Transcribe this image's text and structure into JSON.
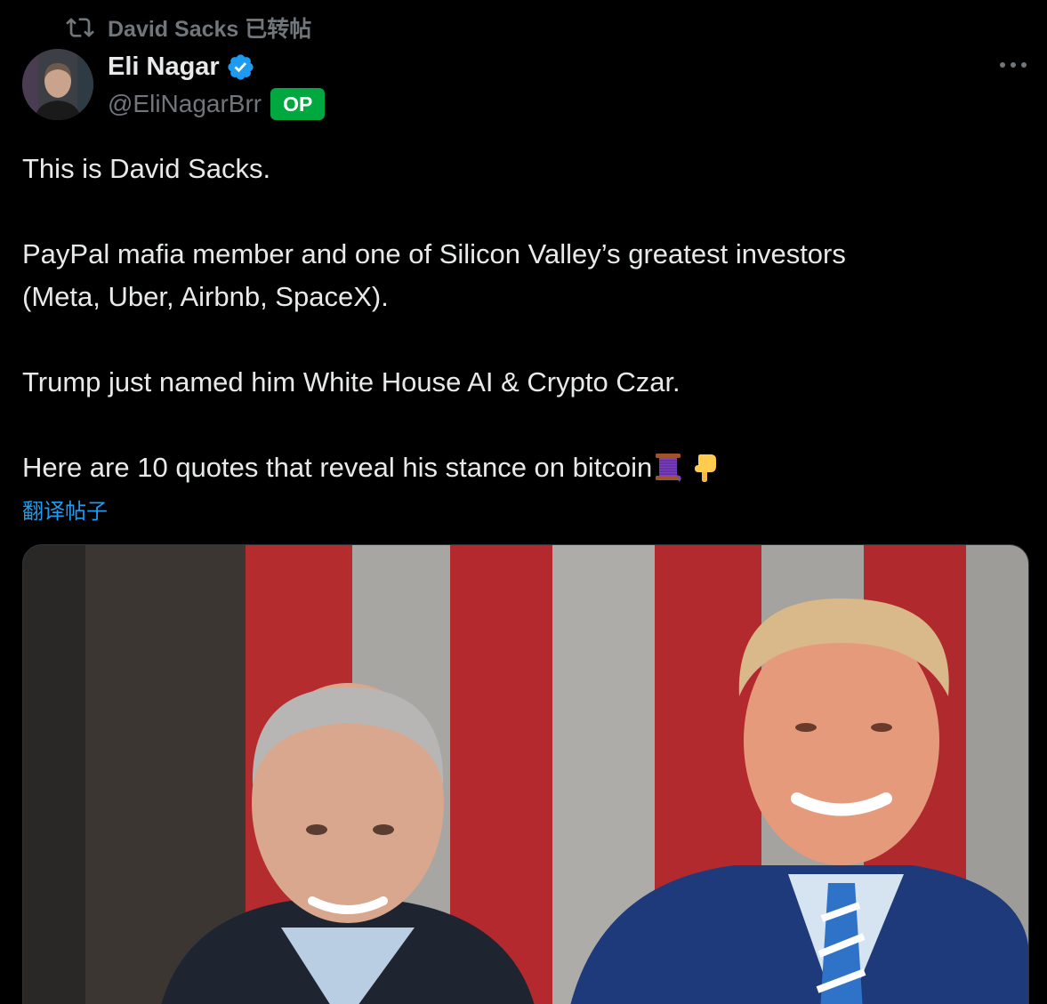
{
  "repost": {
    "icon": "repost-icon",
    "text": "David Sacks 已转帖"
  },
  "author": {
    "name": "Eli Nagar",
    "handle": "@EliNagarBrr",
    "badge": "OP",
    "verified_icon": "verified-badge-icon",
    "verified_color": "#1d9bf0",
    "badge_color": "#00a83f"
  },
  "menu": {
    "icon": "more-options-icon"
  },
  "tweet": {
    "line1": "This is David Sacks.",
    "line2": "PayPal mafia member and one of Silicon Valley’s greatest investors",
    "line3": "(Meta, Uber, Airbnb, SpaceX).",
    "line4": "Trump just named him White House AI & Crypto Czar.",
    "line5": "Here are 10 quotes that reveal his stance on bitcoin",
    "emoji1": "thread-spool-emoji",
    "emoji2": "pointing-down-emoji"
  },
  "translate": {
    "label": "翻译帖子",
    "color": "#1d9bf0"
  },
  "media": {
    "icon": "photo"
  },
  "colors": {
    "background": "#000000",
    "text": "#e7e9ea",
    "muted": "#71767b"
  }
}
